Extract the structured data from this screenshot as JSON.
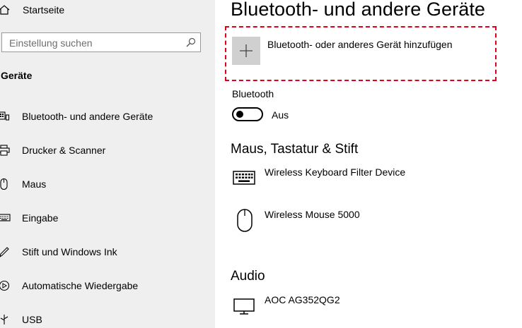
{
  "sidebar": {
    "home_label": "Startseite",
    "search_placeholder": "Einstellung suchen",
    "section_title": "Geräte",
    "items": [
      {
        "label": "Bluetooth- und andere Geräte",
        "icon": "bluetooth-devices-icon"
      },
      {
        "label": "Drucker & Scanner",
        "icon": "printer-icon"
      },
      {
        "label": "Maus",
        "icon": "mouse-icon"
      },
      {
        "label": "Eingabe",
        "icon": "keyboard-icon"
      },
      {
        "label": "Stift und Windows Ink",
        "icon": "pen-icon"
      },
      {
        "label": "Automatische Wiedergabe",
        "icon": "autoplay-icon"
      },
      {
        "label": "USB",
        "icon": "usb-icon"
      }
    ]
  },
  "main": {
    "title": "Bluetooth- und andere Geräte",
    "add_device_label": "Bluetooth- oder anderes Gerät hinzufügen",
    "bluetooth_label": "Bluetooth",
    "bluetooth_state": "Aus",
    "bluetooth_on": false,
    "sections": {
      "input": {
        "title": "Maus, Tastatur & Stift",
        "devices": [
          {
            "name": "Wireless Keyboard Filter Device",
            "icon": "keyboard-icon"
          },
          {
            "name": "Wireless Mouse 5000",
            "icon": "mouse-icon"
          }
        ]
      },
      "audio": {
        "title": "Audio",
        "devices": [
          {
            "name": "AOC AG352QG2",
            "icon": "monitor-icon"
          }
        ]
      }
    },
    "highlight_color": "#e0001a"
  }
}
